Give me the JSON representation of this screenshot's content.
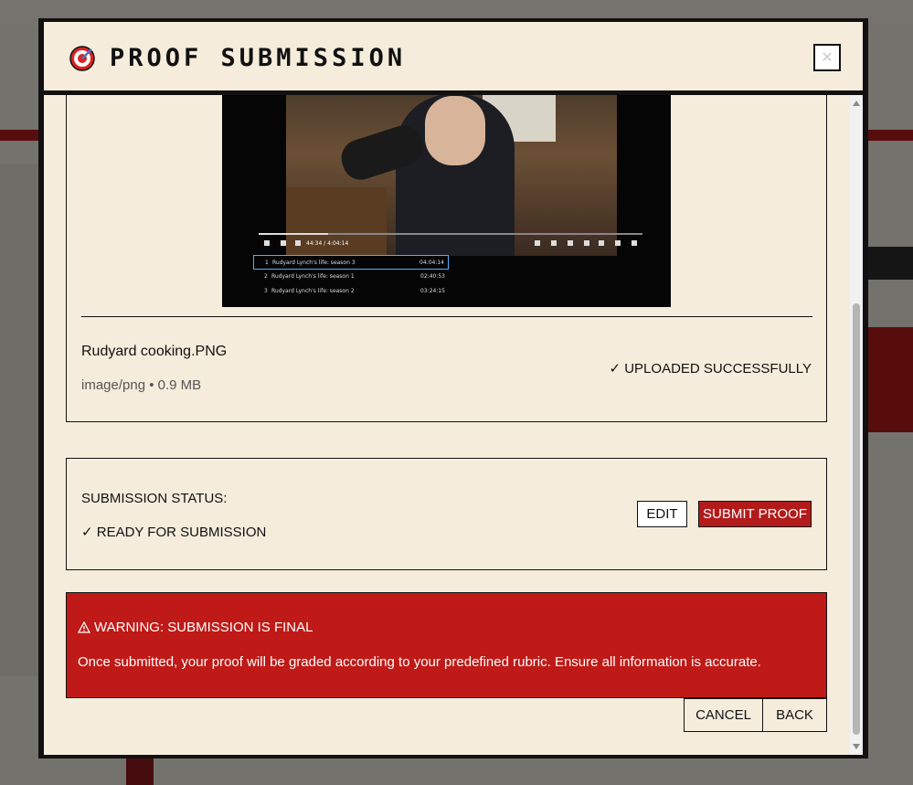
{
  "modal": {
    "title": "PROOF SUBMISSION",
    "close_label": "✕"
  },
  "preview": {
    "player_time": "44:34 / 4:04:14",
    "progress_fraction": 0.18,
    "playlist": [
      {
        "index": "1",
        "title": "Rudyard Lynch's life: season 3",
        "duration": "04:04:14",
        "active": true
      },
      {
        "index": "2",
        "title": "Rudyard Lynch's life: season 1",
        "duration": "02:40:53",
        "active": false
      },
      {
        "index": "3",
        "title": "Rudyard Lynch's life: season 2",
        "duration": "03:24:15",
        "active": false
      }
    ]
  },
  "file": {
    "name": "Rudyard cooking.PNG",
    "meta": "image/png • 0.9 MB",
    "status": "✓ UPLOADED SUCCESSFULLY"
  },
  "submission": {
    "label": "SUBMISSION STATUS:",
    "value": "✓ READY FOR SUBMISSION",
    "edit_label": "EDIT",
    "submit_label": "SUBMIT PROOF"
  },
  "warning": {
    "title": "WARNING: SUBMISSION IS FINAL",
    "text": "Once submitted, your proof will be graded according to your predefined rubric. Ensure all information is accurate."
  },
  "footer": {
    "cancel_label": "CANCEL",
    "back_label": "BACK"
  },
  "colors": {
    "accent_red": "#bf1a17",
    "modal_bg": "#f5ecdc"
  }
}
